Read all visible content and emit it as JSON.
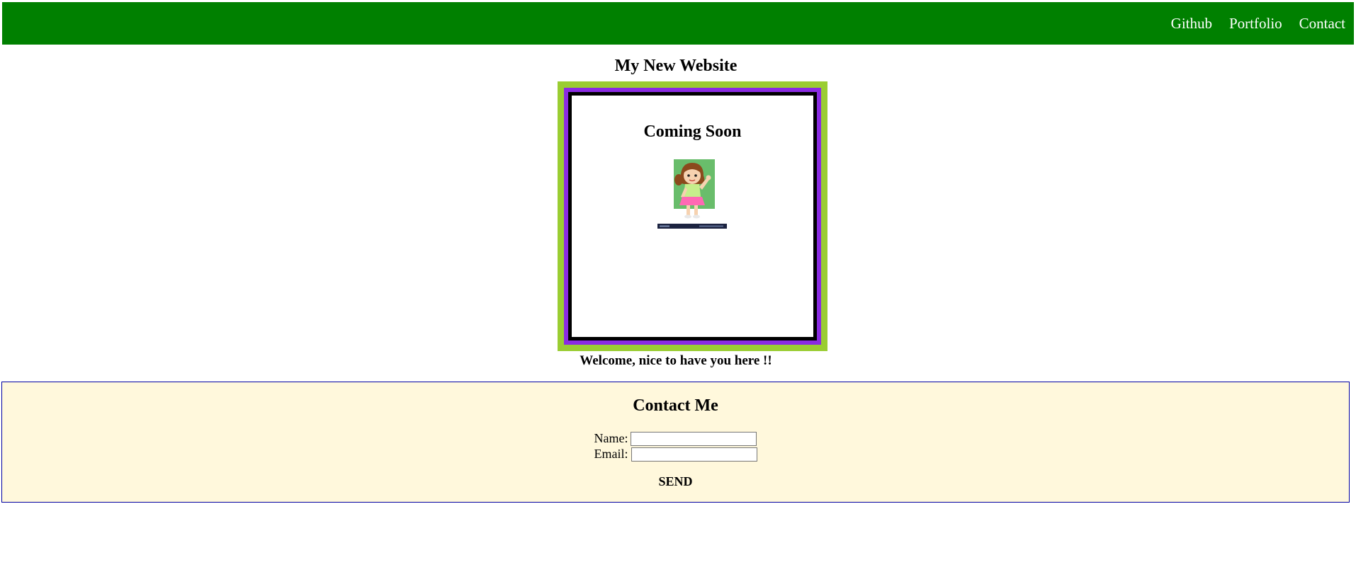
{
  "nav": {
    "links": [
      {
        "label": "Github"
      },
      {
        "label": "Portfolio"
      },
      {
        "label": "Contact"
      }
    ]
  },
  "main": {
    "title": "My New Website",
    "frame": {
      "heading": "Coming Soon",
      "image": "girl-waving-cartoon"
    },
    "welcome": "Welcome, nice to have you here !!"
  },
  "contact": {
    "heading": "Contact Me",
    "name_label": "Name:",
    "name_value": "",
    "email_label": "Email:",
    "email_value": "",
    "send_label": "SEND"
  },
  "colors": {
    "navbar": "#008000",
    "frame_outer": "#9acd32",
    "frame_mid": "#8a2be2",
    "frame_inner_border": "#000000",
    "contact_background": "#fff8dc",
    "contact_border": "#0000a0"
  }
}
